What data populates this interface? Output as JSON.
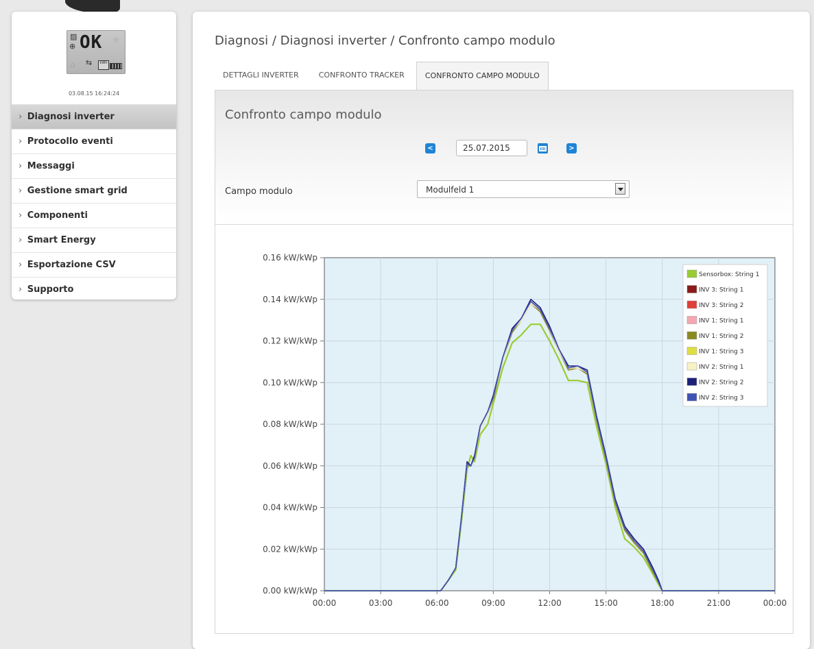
{
  "sidebar": {
    "status": {
      "display": "OK",
      "lcd_mini_text": "kWh",
      "timestamp": "03.08.15 16:24:24"
    },
    "items": [
      {
        "label": "Diagnosi inverter",
        "active": true
      },
      {
        "label": "Protocollo eventi"
      },
      {
        "label": "Messaggi"
      },
      {
        "label": "Gestione smart grid"
      },
      {
        "label": "Componenti"
      },
      {
        "label": "Smart Energy"
      },
      {
        "label": "Esportazione CSV"
      },
      {
        "label": "Supporto"
      }
    ]
  },
  "main": {
    "breadcrumb": "Diagnosi / Diagnosi inverter / Confronto campo modulo",
    "tabs": [
      {
        "label": "DETTAGLI INVERTER"
      },
      {
        "label": "CONFRONTO TRACKER"
      },
      {
        "label": "CONFRONTO CAMPO MODULO",
        "active": true
      }
    ],
    "panel_title": "Confronto campo modulo",
    "date_value": "25.07.2015",
    "field_label": "Campo modulo",
    "select_value": "Modulfeld 1"
  },
  "chart_data": {
    "type": "line",
    "ylim": [
      0,
      0.16
    ],
    "xlim": [
      "00:00",
      "24:00"
    ],
    "grid": true,
    "legend_position": "top-right",
    "y_ticks": [
      "0.00 kW/kWp",
      "0.02 kW/kWp",
      "0.04 kW/kWp",
      "0.06 kW/kWp",
      "0.08 kW/kWp",
      "0.10 kW/kWp",
      "0.12 kW/kWp",
      "0.14 kW/kWp",
      "0.16 kW/kWp"
    ],
    "x_ticks": [
      "00:00",
      "03:00",
      "06:00",
      "09:00",
      "12:00",
      "15:00",
      "18:00",
      "21:00",
      "00:00"
    ],
    "x_hours": [
      0,
      6.2,
      6.6,
      7.0,
      7.3,
      7.6,
      7.8,
      8.0,
      8.3,
      8.7,
      9.0,
      9.5,
      10.0,
      10.5,
      11.0,
      11.5,
      12.0,
      12.5,
      13.0,
      13.5,
      14.0,
      14.5,
      15.0,
      15.5,
      16.0,
      16.5,
      17.0,
      17.5,
      17.8,
      18.0,
      24
    ],
    "series": [
      {
        "name": "Sensorbox: String 1",
        "color": "#99cc33",
        "values": [
          0,
          0,
          0.005,
          0.01,
          0.033,
          0.058,
          0.065,
          0.062,
          0.075,
          0.08,
          0.09,
          0.107,
          0.119,
          0.123,
          0.128,
          0.128,
          0.12,
          0.111,
          0.101,
          0.101,
          0.1,
          0.079,
          0.061,
          0.04,
          0.025,
          0.021,
          0.016,
          0.008,
          0.003,
          0,
          0
        ]
      },
      {
        "name": "INV 3: String 1",
        "color": "#8b1a1a",
        "values": [
          0,
          0,
          0.005,
          0.011,
          0.035,
          0.061,
          0.06,
          0.064,
          0.078,
          0.085,
          0.093,
          0.111,
          0.125,
          0.13,
          0.138,
          0.135,
          0.126,
          0.115,
          0.107,
          0.107,
          0.105,
          0.083,
          0.064,
          0.043,
          0.03,
          0.024,
          0.019,
          0.01,
          0.004,
          0,
          0
        ]
      },
      {
        "name": "INV 3: String 2",
        "color": "#e0403a",
        "values": [
          0,
          0,
          0.005,
          0.011,
          0.035,
          0.061,
          0.06,
          0.065,
          0.079,
          0.086,
          0.093,
          0.112,
          0.125,
          0.131,
          0.139,
          0.135,
          0.126,
          0.116,
          0.107,
          0.108,
          0.105,
          0.083,
          0.064,
          0.043,
          0.03,
          0.024,
          0.019,
          0.01,
          0.004,
          0,
          0
        ]
      },
      {
        "name": "INV 1: String 1",
        "color": "#f4a7b0",
        "values": [
          0,
          0,
          0.005,
          0.011,
          0.035,
          0.06,
          0.06,
          0.064,
          0.078,
          0.085,
          0.092,
          0.111,
          0.124,
          0.13,
          0.138,
          0.134,
          0.125,
          0.115,
          0.106,
          0.107,
          0.104,
          0.082,
          0.063,
          0.042,
          0.029,
          0.023,
          0.018,
          0.009,
          0.004,
          0,
          0
        ]
      },
      {
        "name": "INV 1: String 2",
        "color": "#8a8a22",
        "values": [
          0,
          0,
          0.005,
          0.011,
          0.035,
          0.06,
          0.06,
          0.064,
          0.078,
          0.085,
          0.092,
          0.111,
          0.124,
          0.13,
          0.138,
          0.134,
          0.125,
          0.115,
          0.106,
          0.107,
          0.104,
          0.082,
          0.063,
          0.042,
          0.029,
          0.023,
          0.018,
          0.009,
          0.004,
          0,
          0
        ]
      },
      {
        "name": "INV 1: String 3",
        "color": "#dede44",
        "values": [
          0,
          0,
          0.005,
          0.011,
          0.035,
          0.061,
          0.06,
          0.064,
          0.078,
          0.085,
          0.093,
          0.111,
          0.125,
          0.13,
          0.138,
          0.135,
          0.126,
          0.115,
          0.107,
          0.107,
          0.105,
          0.083,
          0.064,
          0.043,
          0.03,
          0.024,
          0.019,
          0.01,
          0.004,
          0,
          0
        ]
      },
      {
        "name": "INV 2: String 1",
        "color": "#f7f3c4",
        "values": [
          0,
          0,
          0.005,
          0.011,
          0.035,
          0.061,
          0.06,
          0.064,
          0.078,
          0.085,
          0.093,
          0.111,
          0.125,
          0.13,
          0.138,
          0.135,
          0.126,
          0.115,
          0.107,
          0.107,
          0.105,
          0.083,
          0.064,
          0.043,
          0.03,
          0.024,
          0.019,
          0.01,
          0.004,
          0,
          0
        ]
      },
      {
        "name": "INV 2: String 2",
        "color": "#1f1f7a",
        "values": [
          0,
          0,
          0.005,
          0.011,
          0.035,
          0.062,
          0.06,
          0.065,
          0.079,
          0.086,
          0.094,
          0.112,
          0.126,
          0.131,
          0.14,
          0.136,
          0.127,
          0.116,
          0.108,
          0.108,
          0.106,
          0.084,
          0.065,
          0.044,
          0.031,
          0.025,
          0.02,
          0.011,
          0.005,
          0,
          0
        ]
      },
      {
        "name": "INV 2: String 3",
        "color": "#3f53b3",
        "values": [
          0,
          0,
          0.005,
          0.011,
          0.035,
          0.061,
          0.06,
          0.064,
          0.079,
          0.086,
          0.093,
          0.112,
          0.125,
          0.131,
          0.139,
          0.135,
          0.126,
          0.116,
          0.107,
          0.108,
          0.105,
          0.083,
          0.064,
          0.043,
          0.03,
          0.024,
          0.019,
          0.01,
          0.004,
          0,
          0
        ]
      }
    ]
  }
}
